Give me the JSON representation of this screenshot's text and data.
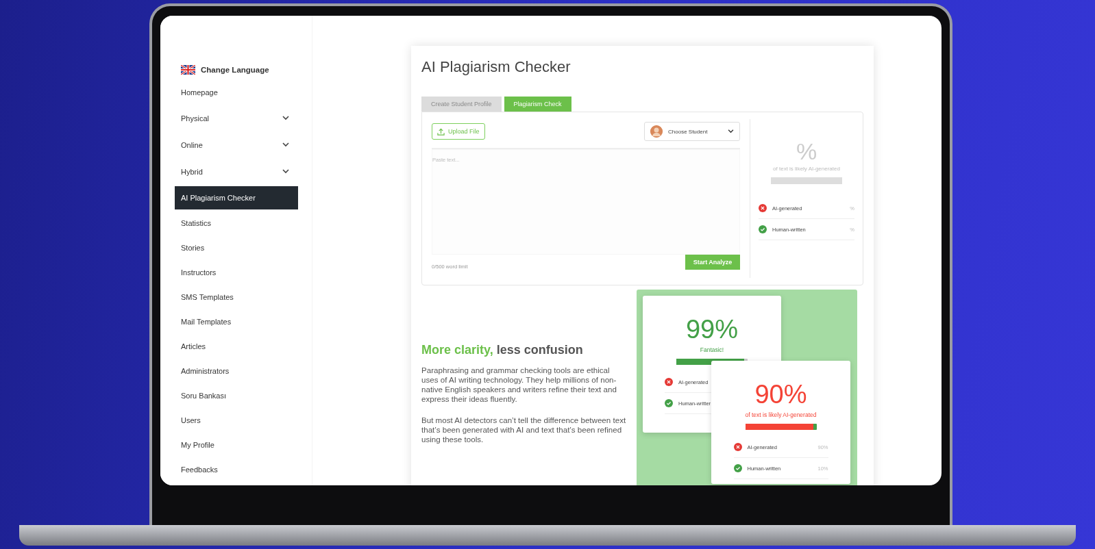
{
  "sidebar": {
    "language": {
      "label": "Change Language"
    },
    "items": [
      {
        "label": "Homepage",
        "expandable": false,
        "selected": false
      },
      {
        "label": "Physical",
        "expandable": true,
        "selected": false
      },
      {
        "label": "Online",
        "expandable": true,
        "selected": false
      },
      {
        "label": "Hybrid",
        "expandable": true,
        "selected": false
      },
      {
        "label": "AI Plagiarism Checker",
        "expandable": false,
        "selected": true
      },
      {
        "label": "Statistics",
        "expandable": false,
        "selected": false
      },
      {
        "label": "Stories",
        "expandable": false,
        "selected": false
      },
      {
        "label": "Instructors",
        "expandable": false,
        "selected": false
      },
      {
        "label": "SMS Templates",
        "expandable": false,
        "selected": false
      },
      {
        "label": "Mail Templates",
        "expandable": false,
        "selected": false
      },
      {
        "label": "Articles",
        "expandable": false,
        "selected": false
      },
      {
        "label": "Administrators",
        "expandable": false,
        "selected": false
      },
      {
        "label": "Soru Bankası",
        "expandable": false,
        "selected": false
      },
      {
        "label": "Users",
        "expandable": false,
        "selected": false
      },
      {
        "label": "My Profile",
        "expandable": false,
        "selected": false
      },
      {
        "label": "Feedbacks",
        "expandable": false,
        "selected": false
      }
    ]
  },
  "page_title": "AI Plagiarism Checker",
  "tabs": [
    {
      "label": "Create Student Profile",
      "selected": false
    },
    {
      "label": "Plagiarism Check",
      "selected": true
    }
  ],
  "checker": {
    "upload_button": "Upload File",
    "student_select": {
      "placeholder": "Choose Student"
    },
    "text_area": {
      "placeholder": "Paste text..."
    },
    "word_limit": "0/500 word limit",
    "analyze_button": "Start Analyze",
    "result": {
      "percent": "%",
      "caption": "of text is likely AI-generated",
      "rows": [
        {
          "kind": "ai",
          "label": "AI-generated",
          "value": "%"
        },
        {
          "kind": "human",
          "label": "Human-written",
          "value": "%"
        }
      ]
    }
  },
  "promo": {
    "heading_accent": "More clarity,",
    "heading_rest": "less confusion",
    "paragraphs": [
      "Paraphrasing and grammar checking tools are ethical uses of AI writing technology. They help millions of non-native English speakers and writers refine their text and express their ideas fluently.",
      "But most AI detectors can’t tell the difference between text that’s been generated with AI and text that’s been refined using these tools."
    ],
    "cards": [
      {
        "kind": "good",
        "percent": "99%",
        "caption": "Fantasic!",
        "level": 0.95,
        "rows": [
          {
            "kind": "ai",
            "label": "AI-generated"
          },
          {
            "kind": "human",
            "label": "Human-writter"
          }
        ]
      },
      {
        "kind": "bad",
        "percent": "90%",
        "caption": "of text is likely AI-generated",
        "level": 0.96,
        "rows": [
          {
            "kind": "ai",
            "label": "AI-generated",
            "value": "90%"
          },
          {
            "kind": "human",
            "label": "Human-written",
            "value": "10%"
          }
        ]
      }
    ]
  }
}
